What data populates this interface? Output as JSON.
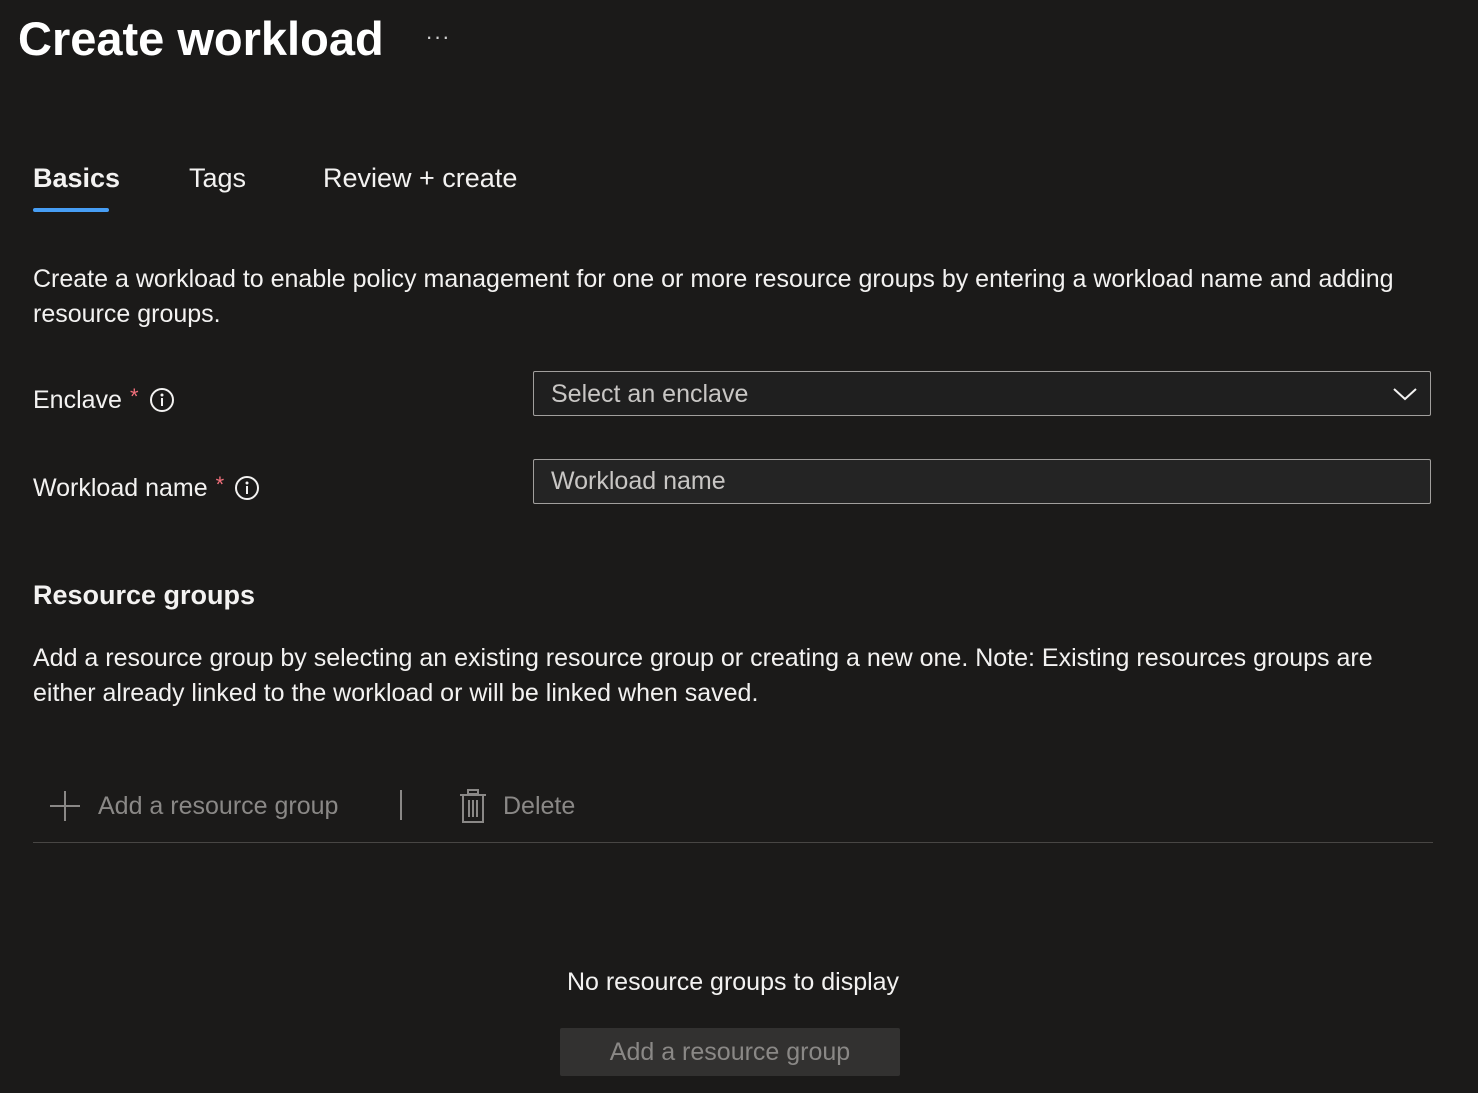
{
  "header": {
    "title": "Create workload",
    "more_label": "···"
  },
  "tabs": [
    {
      "label": "Basics",
      "selected": true
    },
    {
      "label": "Tags",
      "selected": false
    },
    {
      "label": "Review + create",
      "selected": false
    }
  ],
  "intro": {
    "text": "Create a workload to enable policy management for one or more resource groups by entering a workload name and adding resource groups."
  },
  "form": {
    "enclave": {
      "label": "Enclave",
      "required_mark": "*",
      "placeholder": "Select an enclave"
    },
    "workload_name": {
      "label": "Workload name",
      "required_mark": "*",
      "placeholder": "Workload name",
      "value": ""
    }
  },
  "resource_groups": {
    "heading": "Resource groups",
    "description": "Add a resource group by selecting an existing resource group or creating a new one. Note: Existing resources groups are either already linked to the workload or will be linked when saved.",
    "commands": {
      "add_label": "Add a resource group",
      "delete_label": "Delete"
    },
    "empty_state": {
      "text": "No resource groups to display",
      "button_label": "Add a resource group"
    }
  },
  "colors": {
    "background": "#1b1a19",
    "accent": "#479ef5",
    "required": "#f1707b",
    "disabled_text": "#8a8886"
  }
}
